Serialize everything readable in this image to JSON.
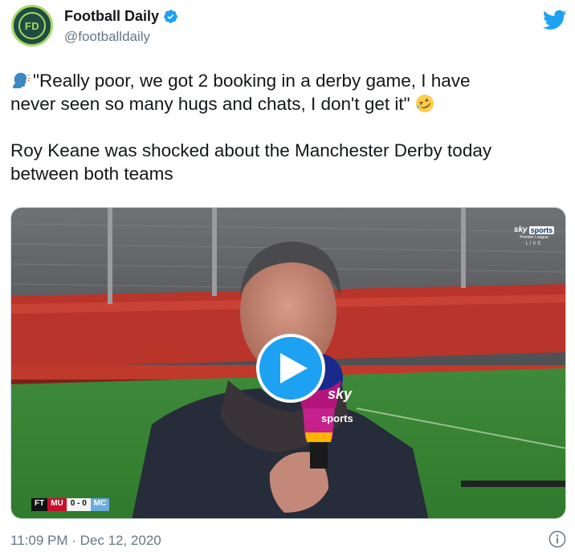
{
  "account": {
    "display_name": "Football Daily",
    "handle": "@footballdaily",
    "avatar_text": "FD",
    "verified": true
  },
  "tweet": {
    "quote_line1": "\"Really poor, we got 2 booking in a derby game, I have",
    "quote_line2": "never seen so many hugs and chats, I don't get it\"",
    "body_line1": "Roy Keane was shocked about the Manchester Derby today",
    "body_line2": "between both teams",
    "emojis": [
      "speaking-head-emoji",
      "rolling-on-floor-laughing-emoji"
    ]
  },
  "media": {
    "type": "video",
    "broadcaster_logo": {
      "sky": "sky",
      "sports": "sports",
      "league": "Premier League",
      "live": "LIVE"
    },
    "mic_flag": {
      "sky": "sky",
      "sports": "sports"
    },
    "scoreboard": {
      "status": "FT",
      "home": "MU",
      "score": "0 - 0",
      "away": "MC"
    }
  },
  "footer": {
    "timestamp": "11:09 PM · Dec 12, 2020"
  },
  "colors": {
    "twitter_blue": "#1da1f2",
    "text_primary": "#14171a",
    "text_secondary": "#657786",
    "home_team": "#c8102e",
    "away_team": "#6cabdd"
  }
}
